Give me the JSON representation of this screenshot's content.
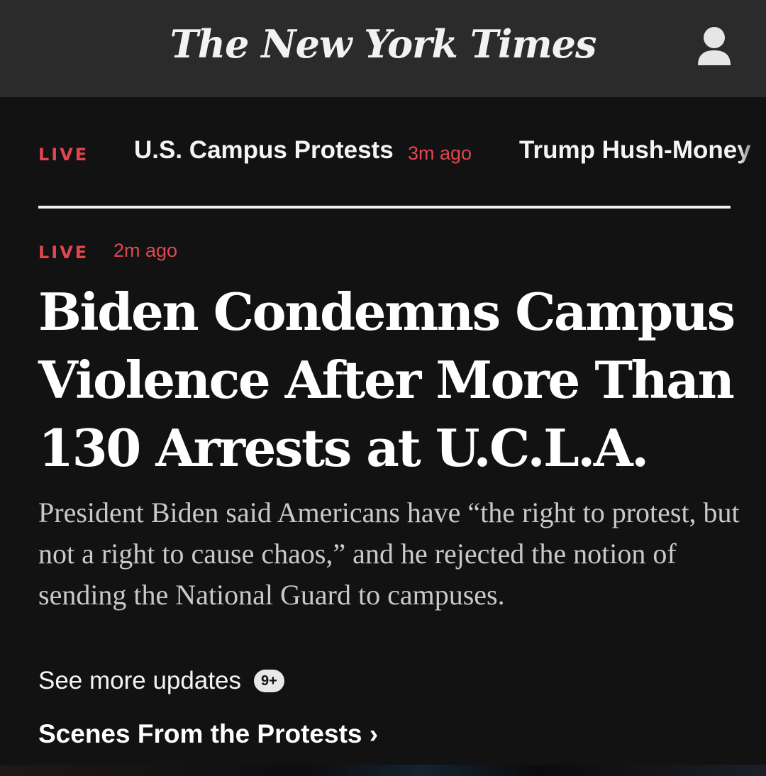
{
  "header": {
    "masthead": "The New York Times",
    "account_icon": "person-icon"
  },
  "ticker": {
    "live_label": "LIVE",
    "items": [
      {
        "label": "U.S. Campus Protests",
        "time": "3m ago"
      },
      {
        "label": "Trump Hush-Money"
      }
    ]
  },
  "story": {
    "live_label": "LIVE",
    "time": "2m ago",
    "headline": "Biden Condemns Campus Violence After More Than 130 Arrests at U.C.L.A.",
    "summary": "President Biden said Americans have “the right to protest, but not a right to cause chaos,” and he rejected the notion of sending the National Guard to campuses.",
    "more_updates_label": "See more updates",
    "more_updates_badge": "9+",
    "related_link": "Scenes From the Protests ›"
  },
  "colors": {
    "live_red": "#e0464f",
    "background": "#121212",
    "header_bar": "#2b2b2b"
  }
}
